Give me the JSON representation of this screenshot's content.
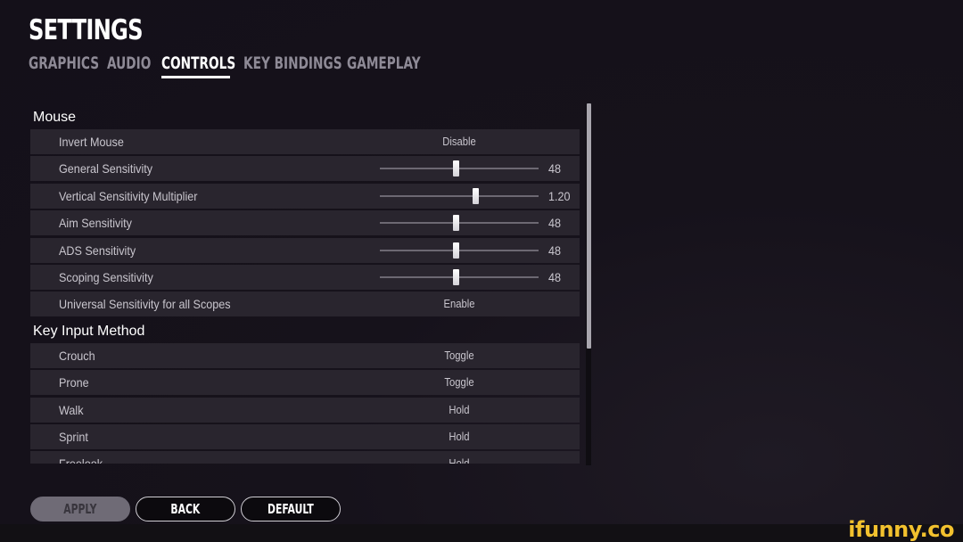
{
  "header": {
    "title": "SETTINGS"
  },
  "tabs": [
    {
      "label": "GRAPHICS",
      "active": false
    },
    {
      "label": "AUDIO",
      "active": false
    },
    {
      "label": "CONTROLS",
      "active": true
    },
    {
      "label": "KEY BINDINGS",
      "active": false
    },
    {
      "label": "GAMEPLAY",
      "active": false
    }
  ],
  "sections": {
    "mouse": {
      "title": "Mouse",
      "rows": [
        {
          "label": "Invert Mouse",
          "type": "option",
          "value": "Disable"
        },
        {
          "label": "General Sensitivity",
          "type": "slider",
          "value": "48",
          "fraction": 0.48
        },
        {
          "label": "Vertical Sensitivity Multiplier",
          "type": "slider",
          "value": "1.20",
          "fraction": 0.6
        },
        {
          "label": "Aim Sensitivity",
          "type": "slider",
          "value": "48",
          "fraction": 0.48
        },
        {
          "label": "ADS Sensitivity",
          "type": "slider",
          "value": "48",
          "fraction": 0.48
        },
        {
          "label": "Scoping Sensitivity",
          "type": "slider",
          "value": "48",
          "fraction": 0.48
        },
        {
          "label": "Universal Sensitivity for all Scopes",
          "type": "option",
          "value": "Enable"
        }
      ]
    },
    "key_input": {
      "title": "Key Input Method",
      "rows": [
        {
          "label": "Crouch",
          "type": "option",
          "value": "Toggle"
        },
        {
          "label": "Prone",
          "type": "option",
          "value": "Toggle"
        },
        {
          "label": "Walk",
          "type": "option",
          "value": "Hold"
        },
        {
          "label": "Sprint",
          "type": "option",
          "value": "Hold"
        },
        {
          "label": "Freelook",
          "type": "option",
          "value": "Hold"
        }
      ]
    }
  },
  "scrollbar": {
    "position_fraction": 0.0,
    "visible_fraction": 0.68
  },
  "buttons": {
    "apply": "APPLY",
    "back": "BACK",
    "default": "DEFAULT"
  },
  "watermark": "ifunny.co"
}
